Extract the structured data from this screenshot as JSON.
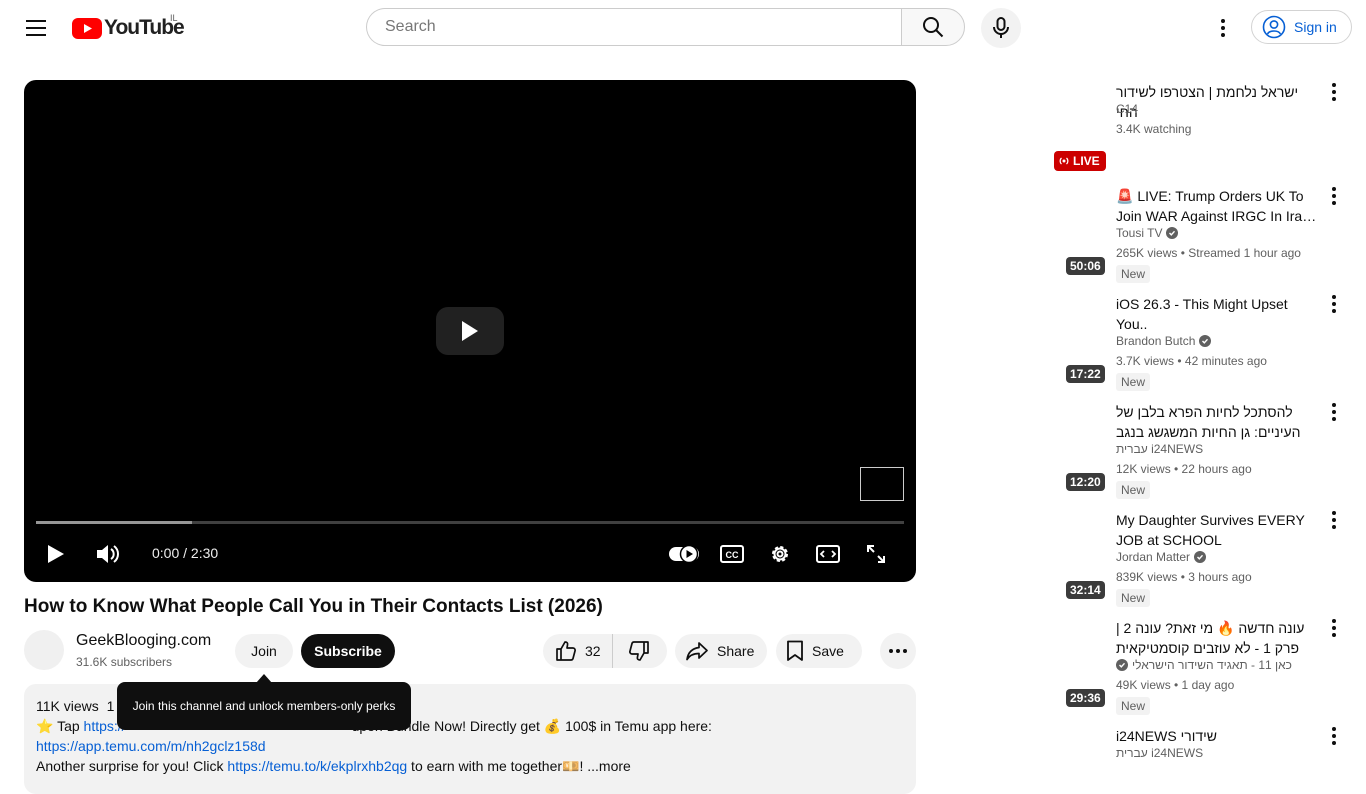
{
  "masthead": {
    "logo_text": "YouTube",
    "country": "IL",
    "search_placeholder": "Search",
    "signin_label": "Sign in"
  },
  "player": {
    "time": "0:00 / 2:30",
    "loaded_fraction": 0.18
  },
  "video": {
    "title": "How to Know What People Call You in Their Contacts List (2026)",
    "channel_name": "GeekBlooging.com",
    "subscribers": "31.6K subscribers",
    "join_label": "Join",
    "subscribe_label": "Subscribe",
    "likes": "32",
    "share_label": "Share",
    "save_label": "Save",
    "join_tooltip": "Join this channel and unlock members-only perks"
  },
  "description": {
    "views": "11K views",
    "views_tail": "1",
    "line2_prefix": "⭐ Tap ",
    "line2_link": "https://",
    "line2_text": "upon Bundle Now! Directly get 💰 100$ in Temu app here:",
    "line3_link": "https://app.temu.com/m/nh2gclz158d",
    "line4_prefix": "Another surprise for you! Click ",
    "line4_link": "https://temu.to/k/ekplrxhb2qg",
    "line4_text": " to earn with me together💴! ",
    "more_label": "...more"
  },
  "recommendations": [
    {
      "title": "ישראל נלחמת | הצטרפו לשידור החי",
      "rtl": true,
      "channel": "C14",
      "verified": false,
      "meta": "3.4K watching",
      "badge_live": "LIVE"
    },
    {
      "title": "🚨 LIVE: Trump Orders UK To Join WAR Against IRGC In Ira…",
      "rtl": false,
      "channel": "Tousi TV",
      "verified": true,
      "meta": "265K views • Streamed 1 hour ago",
      "new": "New",
      "duration": "50:06"
    },
    {
      "title": "iOS 26.3 - This Might Upset You..",
      "rtl": false,
      "channel": "Brandon Butch",
      "verified": true,
      "meta": "3.7K views • 42 minutes ago",
      "new": "New",
      "duration": "17:22"
    },
    {
      "title": "להסתכל לחיות הפרא בלבן של העיניים: גן החיות המשגשג בנגב",
      "rtl": true,
      "channel": "i24NEWS עברית",
      "verified": false,
      "meta": "12K views • 22 hours ago",
      "new": "New",
      "duration": "12:20"
    },
    {
      "title": "My Daughter Survives EVERY JOB at SCHOOL",
      "rtl": false,
      "channel": "Jordan Matter",
      "verified": true,
      "meta": "839K views • 3 hours ago",
      "new": "New",
      "duration": "32:14"
    },
    {
      "title": "עונה חדשה 🔥 מי זאת? עונה 2 | פרק 1 - לא עוזבים קוסמטיקאית",
      "rtl": true,
      "channel": "כאן 11 - תאגיד השידור הישראלי",
      "verified": true,
      "meta": "49K views • 1 day ago",
      "new": "New",
      "duration": "29:36"
    },
    {
      "title": "שידורי i24NEWS",
      "rtl": true,
      "channel": "i24NEWS עברית",
      "verified": false
    }
  ]
}
